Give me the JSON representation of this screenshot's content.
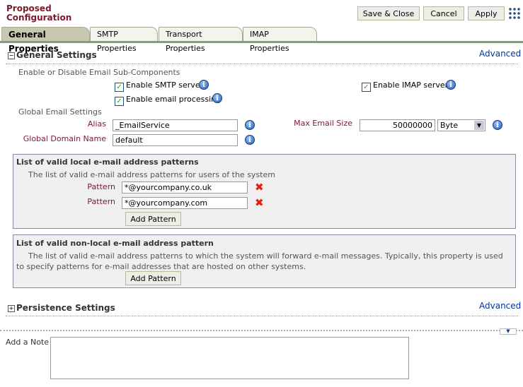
{
  "header": {
    "title": "Proposed Configuration",
    "buttons": {
      "save_close": "Save & Close",
      "cancel": "Cancel",
      "apply": "Apply"
    }
  },
  "tabs": [
    {
      "label": "General Properties",
      "active": true
    },
    {
      "label": "SMTP Properties"
    },
    {
      "label": "Transport Properties"
    },
    {
      "label": "IMAP Properties"
    }
  ],
  "general": {
    "title": "General Settings",
    "advanced": "Advanced",
    "subcomponents_label": "Enable or Disable Email Sub-Components",
    "checkboxes": {
      "smtp": {
        "label": "Enable SMTP server",
        "checked": true
      },
      "email_processing": {
        "label": "Enable email processing",
        "checked": true
      },
      "imap": {
        "label": "Enable IMAP server",
        "checked": true
      }
    },
    "global_label": "Global Email Settings",
    "alias": {
      "label": "Alias",
      "value": "_EmailService"
    },
    "domain": {
      "label": "Global Domain Name",
      "value": "default"
    },
    "max_size": {
      "label": "Max Email Size",
      "value": "50000000",
      "unit": "Byte"
    }
  },
  "local_patterns": {
    "title": "List of valid local e-mail address patterns",
    "description": "The list of valid e-mail address patterns for users of the system",
    "pattern_label": "Pattern",
    "patterns": [
      "*@yourcompany.co.uk",
      "*@yourcompany.com"
    ],
    "add_button": "Add Pattern"
  },
  "nonlocal_patterns": {
    "title": "List of valid non-local e-mail address pattern",
    "description": "The list of valid e-mail address patterns to which the system will forward e-mail messages. Typically, this property is used to specify patterns for e-mail addresses that are hosted on other systems.",
    "add_button": "Add Pattern"
  },
  "persistence": {
    "title": "Persistence Settings",
    "advanced": "Advanced"
  },
  "note": {
    "label": "Add a Note",
    "value": ""
  },
  "colors": {
    "label_red": "#7b1a2e",
    "link_blue": "#003399"
  }
}
